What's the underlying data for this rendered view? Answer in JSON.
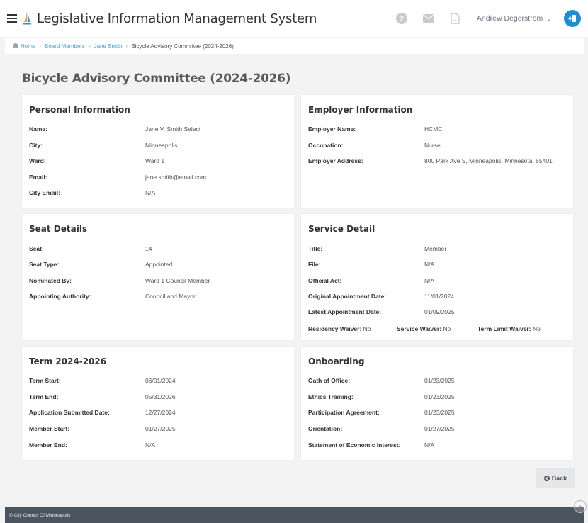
{
  "header": {
    "title": "Legislative Information Management System",
    "user_name": "Andrew Degerstrom",
    "icons": [
      "menu-icon",
      "logo-icon",
      "help-icon",
      "mail-icon",
      "document-icon",
      "logout-icon"
    ]
  },
  "breadcrumb": {
    "home": "Home",
    "board_members": "Board Members",
    "member": "Jane Smith",
    "current": "Bicycle Advisory Committee (2024-2026)"
  },
  "page_title": "Bicycle Advisory Committee (2024-2026)",
  "personal": {
    "title": "Personal Information",
    "rows": [
      {
        "label": "Name:",
        "value": "Jane V. Smith Select"
      },
      {
        "label": "City:",
        "value": "Minneapolis"
      },
      {
        "label": "Ward:",
        "value": "Ward 1"
      },
      {
        "label": "Email:",
        "value": "jane.smith@email.com"
      },
      {
        "label": "City Email:",
        "value": "N/A"
      }
    ]
  },
  "employer": {
    "title": "Employer Information",
    "rows": [
      {
        "label": "Employer Name:",
        "value": "HCMC"
      },
      {
        "label": "Occupation:",
        "value": "Nurse"
      },
      {
        "label": "Employer Address:",
        "value": "800 Park Ave S, Minneapolis, Minnesota, 55401"
      }
    ]
  },
  "seat": {
    "title": "Seat Details",
    "rows": [
      {
        "label": "Seat:",
        "value": "14"
      },
      {
        "label": "Seat Type:",
        "value": "Appointed"
      },
      {
        "label": "Nominated By:",
        "value": "Ward 1 Council Member"
      },
      {
        "label": "Appointing Authority:",
        "value": "Council and Mayor"
      }
    ]
  },
  "service": {
    "title": "Service Detail",
    "rows": [
      {
        "label": "Title:",
        "value": "Member"
      },
      {
        "label": "File:",
        "value": "N/A"
      },
      {
        "label": "Official Act:",
        "value": "N/A"
      },
      {
        "label": "Original Appointment Date:",
        "value": "11/01/2024"
      },
      {
        "label": "Latest Appointment Date:",
        "value": "01/09/2025"
      }
    ],
    "waivers": [
      {
        "label": "Residency Waiver:",
        "value": "No"
      },
      {
        "label": "Service Waiver:",
        "value": "No"
      },
      {
        "label": "Term Limit Waiver:",
        "value": "No"
      }
    ]
  },
  "term": {
    "title": "Term 2024-2026",
    "rows": [
      {
        "label": "Term Start:",
        "value": "06/01/2024"
      },
      {
        "label": "Term End:",
        "value": "05/31/2026"
      },
      {
        "label": "Application Submitted Date:",
        "value": "12/27/2024"
      },
      {
        "label": "Member Start:",
        "value": "01/27/2025"
      },
      {
        "label": "Member End:",
        "value": "N/A"
      }
    ]
  },
  "onboarding": {
    "title": "Onboarding",
    "rows": [
      {
        "label": "Oath of Office:",
        "value": "01/23/2025"
      },
      {
        "label": "Ethics Training:",
        "value": "01/23/2025"
      },
      {
        "label": "Participation Agreement:",
        "value": "01/23/2025"
      },
      {
        "label": "Orientation:",
        "value": "01/27/2025"
      },
      {
        "label": "Statement of Economic Interest:",
        "value": "N/A"
      }
    ]
  },
  "back_label": "Back",
  "footer_text": "© City Council Of Minneapolis",
  "colors": {
    "accent": "#1c8fd2",
    "link": "#48a1d9",
    "footer": "#4a5560",
    "background": "#f3f3f4"
  }
}
